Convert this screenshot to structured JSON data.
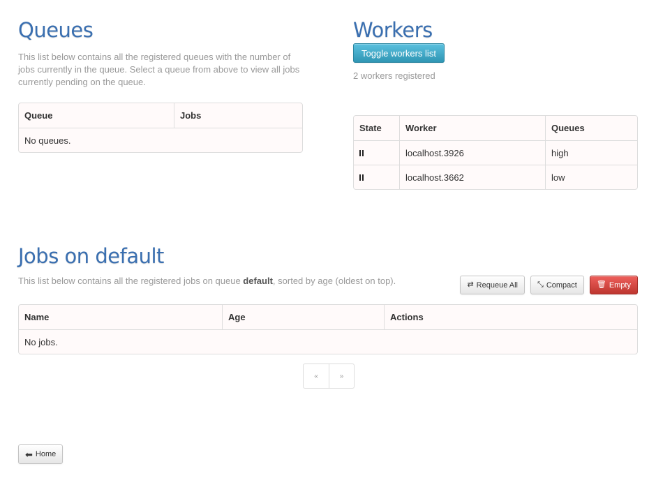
{
  "queues": {
    "title": "Queues",
    "description": "This list below contains all the registered queues with the number of jobs currently in the queue. Select a queue from above to view all jobs currently pending on the queue.",
    "columns": [
      "Queue",
      "Jobs"
    ],
    "empty_text": "No queues."
  },
  "workers": {
    "title": "Workers",
    "toggle_label": "Toggle workers list",
    "count_text": "2 workers registered",
    "columns": [
      "State",
      "Worker",
      "Queues"
    ],
    "rows": [
      {
        "state_icon": "pause-icon",
        "worker": "localhost.3926",
        "queues": "high"
      },
      {
        "state_icon": "pause-icon",
        "worker": "localhost.3662",
        "queues": "low"
      }
    ]
  },
  "jobs": {
    "title": "Jobs on default",
    "desc_before": "This list below contains all the registered jobs on queue ",
    "desc_queue": "default",
    "desc_after": ", sorted by age (oldest on top).",
    "requeue_label": "Requeue All",
    "compact_label": "Compact",
    "empty_label": "Empty",
    "columns": [
      "Name",
      "Age",
      "Actions"
    ],
    "empty_text": "No jobs."
  },
  "pager": {
    "prev": "«",
    "next": "»"
  },
  "home_label": "Home",
  "colors": {
    "accent": "#3a6fb0",
    "info": "#2f96b4",
    "danger": "#bd362f"
  }
}
